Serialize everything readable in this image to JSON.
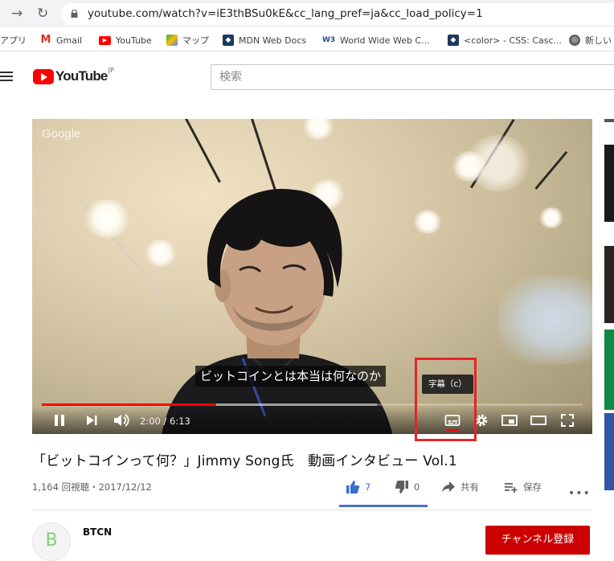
{
  "browser": {
    "url": "youtube.com/watch?v=iE3thBSu0kE&cc_lang_pref=ja&cc_load_policy=1",
    "bookmarks": [
      {
        "label": "アプリ",
        "icon": "apps-grid-icon"
      },
      {
        "label": "Gmail",
        "icon": "gmail-icon"
      },
      {
        "label": "YouTube",
        "icon": "youtube-icon"
      },
      {
        "label": "マップ",
        "icon": "maps-icon"
      },
      {
        "label": "MDN Web Docs",
        "icon": "mdn-icon"
      },
      {
        "label": "World Wide Web C...",
        "icon": "w3c-icon"
      },
      {
        "label": "<color> - CSS: Casc...",
        "icon": "mdn-icon"
      },
      {
        "label": "新しい",
        "icon": "globe-icon"
      }
    ]
  },
  "header": {
    "logo_text": "YouTube",
    "logo_region": "JP",
    "search_placeholder": "検索"
  },
  "player": {
    "watermark": "Google",
    "subtitle": "ビットコインとは本当は何なのか",
    "tooltip": "字幕（c）",
    "time": "2:00 / 6:13",
    "progress": 0.322,
    "buffered": 0.62
  },
  "video": {
    "title": "「ビットコインって何？」Jimmy Song氏　動画インタビュー Vol.1",
    "meta": "1,164 回視聴・2017/12/12",
    "likes": "7",
    "dislikes": "0",
    "share_label": "共有",
    "save_label": "保存"
  },
  "channel": {
    "name": "BTCN",
    "subscribe_label": "チャンネル登録"
  },
  "colors": {
    "brand_red": "#ff0000",
    "highlight": "#e32626",
    "like_blue": "#4a73c8"
  }
}
